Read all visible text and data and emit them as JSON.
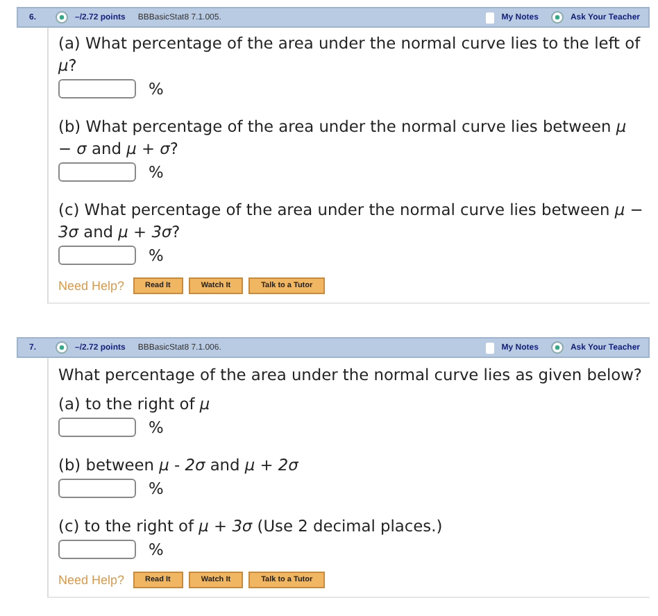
{
  "questions": [
    {
      "number": "6.",
      "points": "–/2.72 points",
      "source": "BBBasicStat8 7.1.005.",
      "notes": "My Notes",
      "ask": "Ask Your Teacher",
      "parts": [
        {
          "text": "(a) What percentage of the area under the normal curve lies to the left of *μ*?",
          "unit": "%"
        },
        {
          "text": "(b) What percentage of the area under the normal curve lies between *μ* − *σ* and *μ* + *σ*?",
          "unit": "%"
        },
        {
          "text": "(c) What percentage of the area under the normal curve lies between *μ* − *3σ* and *μ* + *3σ*?",
          "unit": "%"
        }
      ],
      "help": {
        "label": "Need Help?",
        "buttons": [
          "Read It",
          "Watch It",
          "Talk to a Tutor"
        ]
      }
    },
    {
      "number": "7.",
      "points": "–/2.72 points",
      "source": "BBBasicStat8 7.1.006.",
      "notes": "My Notes",
      "ask": "Ask Your Teacher",
      "intro": "What percentage of the area under the normal curve lies as given below?",
      "parts": [
        {
          "text": "(a) to the right of *μ*",
          "unit": "%"
        },
        {
          "text": "(b) between *μ* - *2σ* and *μ* + *2σ*",
          "unit": "%"
        },
        {
          "text": "(c) to the right of *μ* + *3σ* (Use 2 decimal places.)",
          "unit": "%"
        }
      ],
      "help": {
        "label": "Need Help?",
        "buttons": [
          "Read It",
          "Watch It",
          "Talk to a Tutor"
        ]
      }
    }
  ]
}
